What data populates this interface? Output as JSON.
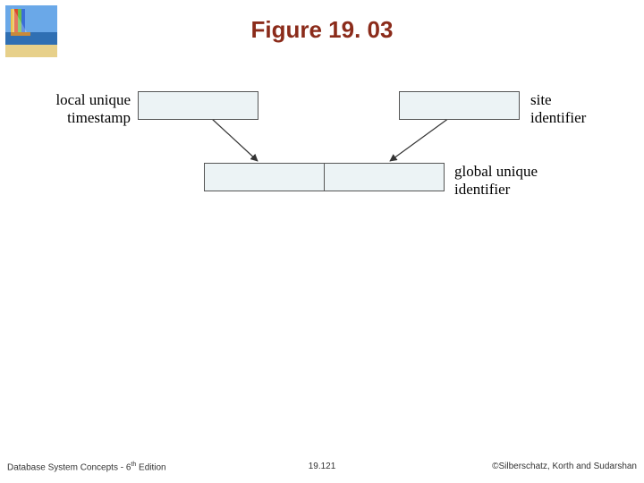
{
  "title": "Figure 19. 03",
  "diagram": {
    "label_left_line1": "local unique",
    "label_left_line2": "timestamp",
    "label_right_line1": "site",
    "label_right_line2": "identifier",
    "label_bottom_line1": "global unique",
    "label_bottom_line2": "identifier"
  },
  "footer": {
    "left_prefix": "Database System Concepts - 6",
    "left_suffix": " Edition",
    "left_sup": "th",
    "center": "19.121",
    "right": "©Silberschatz, Korth and Sudarshan"
  },
  "colors": {
    "title": "#8b2b1a",
    "box_fill": "#ecf3f5"
  }
}
